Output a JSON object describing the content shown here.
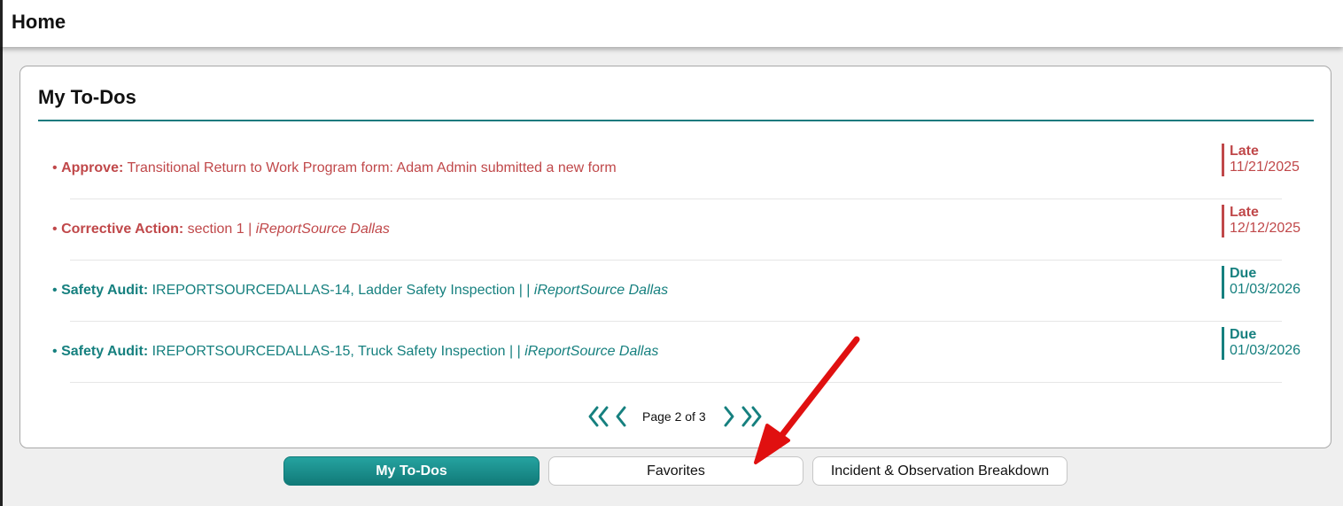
{
  "header": {
    "title": "Home"
  },
  "card": {
    "title": "My To-Dos"
  },
  "todos": [
    {
      "kind": "Approve:",
      "text": " Transitional Return to Work Program form: Adam Admin submitted a new form",
      "location": "",
      "status": "Late",
      "date": "11/21/2025"
    },
    {
      "kind": "Corrective Action:",
      "text": " section 1 | ",
      "location": "iReportSource Dallas",
      "status": "Late",
      "date": "12/12/2025"
    },
    {
      "kind": "Safety Audit:",
      "text": " IREPORTSOURCEDALLAS-14, Ladder Safety Inspection |  | ",
      "location": "iReportSource Dallas",
      "status": "Due",
      "date": "01/03/2026"
    },
    {
      "kind": "Safety Audit:",
      "text": " IREPORTSOURCEDALLAS-15, Truck Safety Inspection |  | ",
      "location": "iReportSource Dallas",
      "status": "Due",
      "date": "01/03/2026"
    }
  ],
  "bullet": "•",
  "pagination": {
    "label": "Page 2 of 3"
  },
  "tabs": [
    "My To-Dos",
    "Favorites",
    "Incident & Observation Breakdown"
  ],
  "colors": {
    "late": "#c0484a",
    "due": "#16807f",
    "accent": "#1a7a7e",
    "annotation_arrow": "#e01010"
  },
  "icons": {
    "first": "double-chevron-left-icon",
    "prev": "chevron-left-icon",
    "next": "chevron-right-icon",
    "last": "double-chevron-right-icon"
  }
}
